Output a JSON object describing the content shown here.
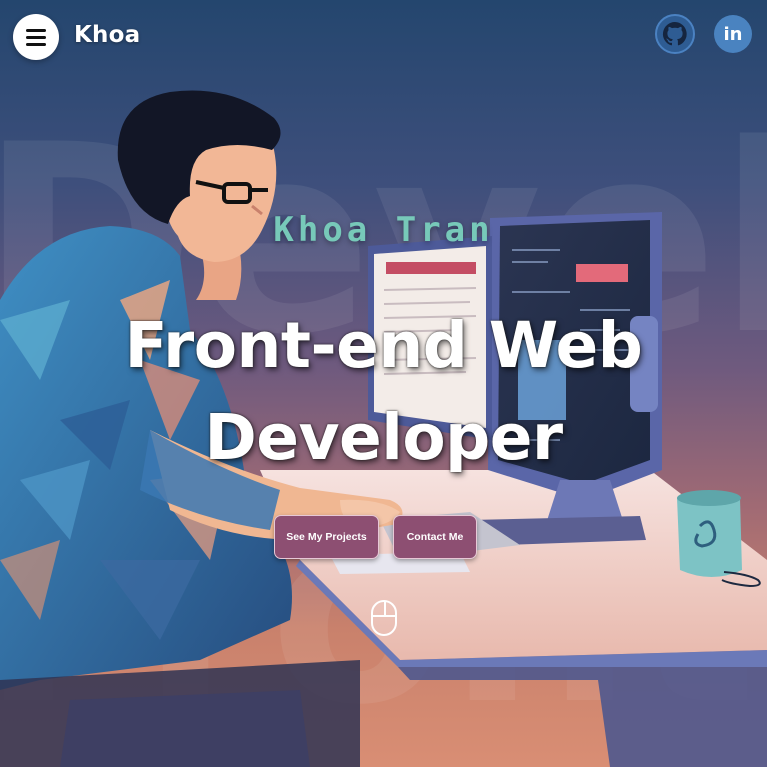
{
  "header": {
    "menu_icon": "hamburger-menu-icon",
    "brand": "Khoa",
    "social": [
      {
        "icon": "github-icon",
        "label": "GitHub"
      },
      {
        "icon": "linkedin-icon",
        "label": "in"
      }
    ]
  },
  "hero": {
    "name": "Khoa Tran",
    "title_line1": "Front-end Web",
    "title_line2": "Developer",
    "primary_cta": "See My Projects",
    "secondary_cta": "Contact Me",
    "scroll_icon": "mouse-scroll-icon",
    "illustration": "developer-at-computer-illustration"
  },
  "colors": {
    "name_accent": "#77c9b9",
    "cta_background": "#8d4f72",
    "sky_top": "#24466e",
    "floor_warm": "#d98e74"
  }
}
